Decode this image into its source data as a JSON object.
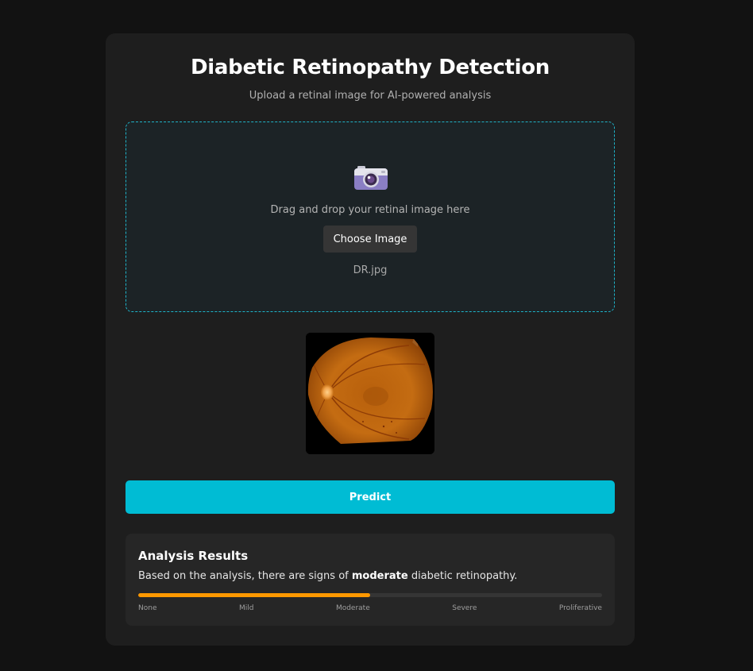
{
  "header": {
    "title": "Diabetic Retinopathy Detection",
    "subtitle": "Upload a retinal image for AI-powered analysis"
  },
  "upload": {
    "icon": "camera-icon",
    "instruction": "Drag and drop your retinal image here",
    "choose_label": "Choose Image",
    "filename": "DR.jpg",
    "border_color": "#1fb3c8"
  },
  "preview": {
    "alt": "retinal fundus image"
  },
  "predict": {
    "label": "Predict",
    "color": "#00bcd4"
  },
  "results": {
    "title": "Analysis Results",
    "text_before": "Based on the analysis, there are signs of ",
    "severity": "moderate",
    "text_after": " diabetic retinopathy.",
    "severity_level_percent": 50,
    "bar_color": "#ff9800",
    "scale": [
      "None",
      "Mild",
      "Moderate",
      "Severe",
      "Proliferative"
    ]
  }
}
